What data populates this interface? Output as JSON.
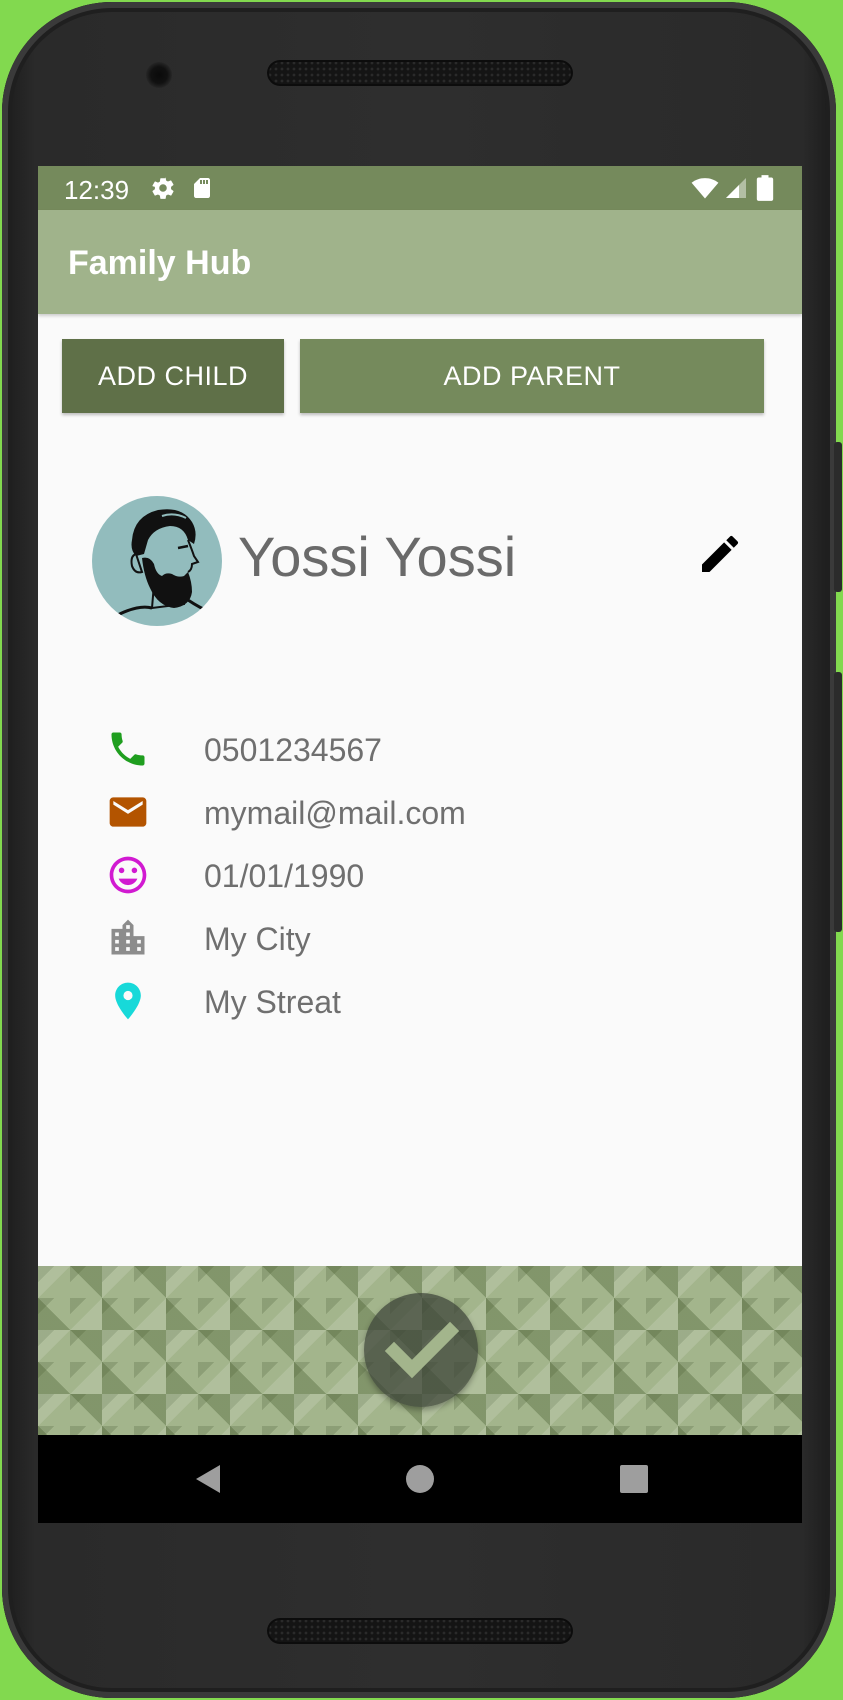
{
  "status_bar": {
    "time": "12:39",
    "left_icons": [
      "gear-icon",
      "sd-card-icon"
    ],
    "right_icons": [
      "wifi-icon",
      "cell-signal-icon",
      "battery-icon"
    ]
  },
  "app_bar": {
    "title": "Family Hub"
  },
  "actions": {
    "add_child": "ADD CHILD",
    "add_parent": "ADD PARENT"
  },
  "profile": {
    "name": "Yossi Yossi",
    "avatar_icon": "bearded-man-avatar",
    "edit_icon": "pencil-icon"
  },
  "details": [
    {
      "icon": "phone-icon",
      "color": "#1f9e1f",
      "value": "0501234567"
    },
    {
      "icon": "email-icon",
      "color": "#b35400",
      "value": "mymail@mail.com"
    },
    {
      "icon": "smiley-icon",
      "color": "#d11ad1",
      "value": "01/01/1990"
    },
    {
      "icon": "city-icon",
      "color": "#8c8c8c",
      "value": "My City"
    },
    {
      "icon": "location-pin-icon",
      "color": "#17d9d9",
      "value": "My Streat"
    }
  ],
  "fab": {
    "icon": "checkmark-icon"
  },
  "nav_bar": {
    "icons": [
      "back-icon",
      "home-icon",
      "recents-icon"
    ]
  },
  "colors": {
    "status_bar": "#758a5c",
    "app_bar": "#a0b38b",
    "button_child": "#5f7048",
    "button_parent": "#758a5c",
    "device_background": "#82d94f"
  }
}
